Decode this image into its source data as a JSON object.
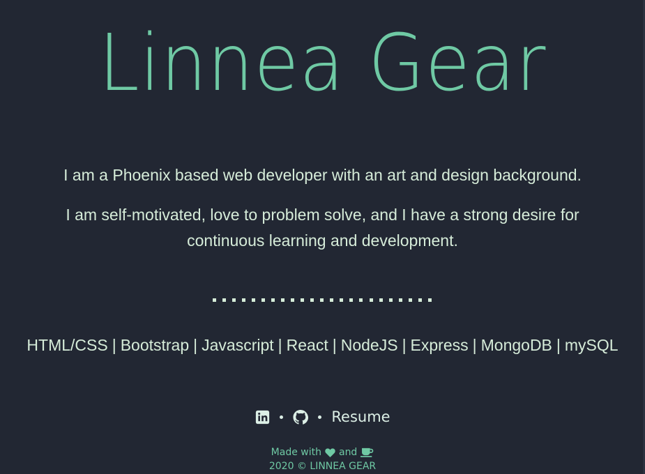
{
  "header": {
    "name": "Linnea Gear"
  },
  "bio": {
    "line1": "I am a Phoenix based web developer with an art and design background.",
    "line2": "I am self-motivated, love to problem solve, and I have a strong desire for continuous learning and development."
  },
  "skills": [
    "HTML/CSS",
    "Bootstrap",
    "Javascript",
    "React",
    "NodeJS",
    "Express",
    "MongoDB",
    "mySQL"
  ],
  "skills_separator": "|",
  "links": {
    "linkedin_icon": "linkedin-icon",
    "github_icon": "github-icon",
    "resume_label": "Resume"
  },
  "footer": {
    "made_with": "Made with",
    "and": "and",
    "heart_icon": "heart-icon",
    "coffee_icon": "coffee-icon",
    "copyright": "2020 © LINNEA GEAR"
  },
  "colors": {
    "background": "#222733",
    "accent": "#6fc9a4",
    "text": "#d6ecd9"
  }
}
